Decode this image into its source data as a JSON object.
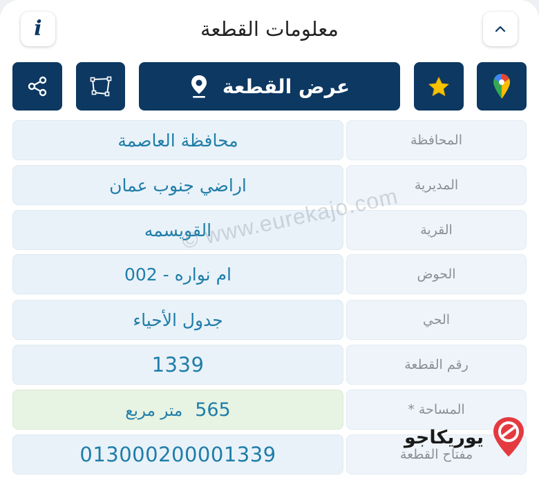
{
  "header": {
    "title": "معلومات القطعة"
  },
  "toolbar": {
    "view_parcel_label": "عرض القطعة"
  },
  "icons": {
    "info": "i",
    "collapse": "chevron-up-icon",
    "share": "share-icon",
    "polygon": "polygon-icon",
    "location": "location-pin-icon",
    "favorite": "star-icon",
    "maps": "google-maps-icon"
  },
  "colors": {
    "primary": "#0c3862",
    "value_text": "#1f7da8",
    "star": "#f5c300",
    "area_highlight": "#e7f3e3"
  },
  "rows": [
    {
      "label": "المحافظة",
      "value": "محافظة العاصمة"
    },
    {
      "label": "المديرية",
      "value": "اراضي جنوب عمان"
    },
    {
      "label": "القرية",
      "value": "القويسمه"
    },
    {
      "label": "الحوض",
      "value": "ام نواره - 002"
    },
    {
      "label": "الحي",
      "value": "جدول الأحياء"
    },
    {
      "label": "رقم القطعة",
      "value": "1339"
    },
    {
      "label": "المساحة *",
      "value_number": "565",
      "value_unit": "متر مربع"
    },
    {
      "label": "مفتاح القطعة",
      "value": "013000200001339"
    }
  ],
  "watermark": "© www.eurekajo.com",
  "brand": {
    "name": "يوريكاجو"
  }
}
